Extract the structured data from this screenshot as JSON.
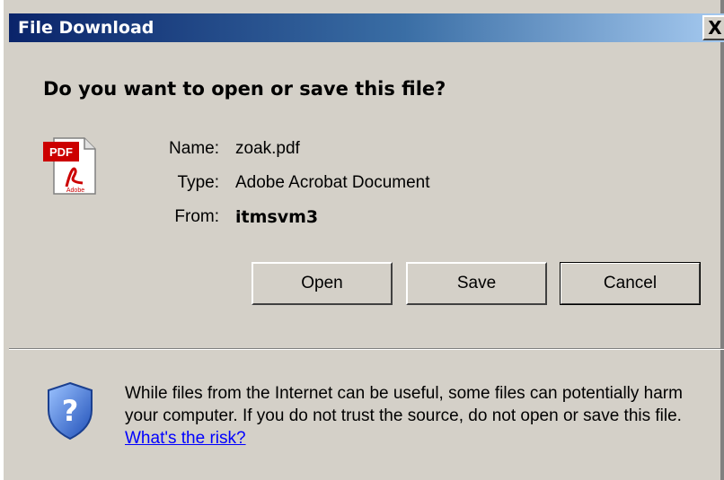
{
  "window": {
    "title": "File Download",
    "close_symbol": "X"
  },
  "dialog": {
    "question": "Do you want to open or save this file?",
    "file": {
      "name_label": "Name:",
      "name_value": "zoak.pdf",
      "type_label": "Type:",
      "type_value": "Adobe Acrobat Document",
      "from_label": "From:",
      "from_value": "itmsvm3"
    },
    "buttons": {
      "open": "Open",
      "save": "Save",
      "cancel": "Cancel"
    },
    "warning": {
      "text": "While files from the Internet can be useful, some files can potentially harm your computer. If you do not trust the source, do not open or save this file.",
      "link": "What's the risk?"
    }
  },
  "icons": {
    "file_icon": "pdf-file-icon",
    "file_icon_label": "PDF",
    "file_icon_brand": "Adobe",
    "security_icon": "shield-question-icon",
    "security_icon_glyph": "?"
  },
  "colors": {
    "titlebar_start": "#0a246a",
    "titlebar_end": "#a6caf0",
    "dialog_bg": "#d4d0c8",
    "link": "#0000ff",
    "pdf_red": "#cc0000"
  }
}
